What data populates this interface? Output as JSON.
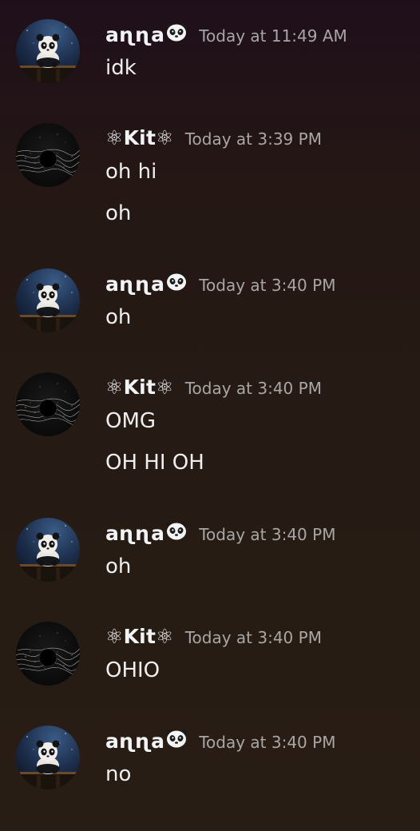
{
  "messages": [
    {
      "author": "aɳɳa",
      "author_emoji": "panda-face",
      "avatar": "panda-avatar",
      "timestamp": "Today at 11:49 AM",
      "lines": [
        "idk"
      ]
    },
    {
      "author": "⚛Kit⚛",
      "author_emoji": "",
      "avatar": "dark-wave-avatar",
      "timestamp": "Today at 3:39 PM",
      "lines": [
        "oh hi",
        "oh"
      ]
    },
    {
      "author": "aɳɳa",
      "author_emoji": "panda-face",
      "avatar": "panda-avatar",
      "timestamp": "Today at 3:40 PM",
      "lines": [
        "oh"
      ]
    },
    {
      "author": "⚛Kit⚛",
      "author_emoji": "",
      "avatar": "dark-wave-avatar",
      "timestamp": "Today at 3:40 PM",
      "lines": [
        "OMG",
        "OH HI OH"
      ]
    },
    {
      "author": "aɳɳa",
      "author_emoji": "panda-face",
      "avatar": "panda-avatar",
      "timestamp": "Today at 3:40 PM",
      "lines": [
        "oh"
      ]
    },
    {
      "author": "⚛Kit⚛",
      "author_emoji": "",
      "avatar": "dark-wave-avatar",
      "timestamp": "Today at 3:40 PM",
      "lines": [
        "OHIO"
      ]
    },
    {
      "author": "aɳɳa",
      "author_emoji": "panda-face",
      "avatar": "panda-avatar",
      "timestamp": "Today at 3:40 PM",
      "lines": [
        "no"
      ]
    }
  ]
}
